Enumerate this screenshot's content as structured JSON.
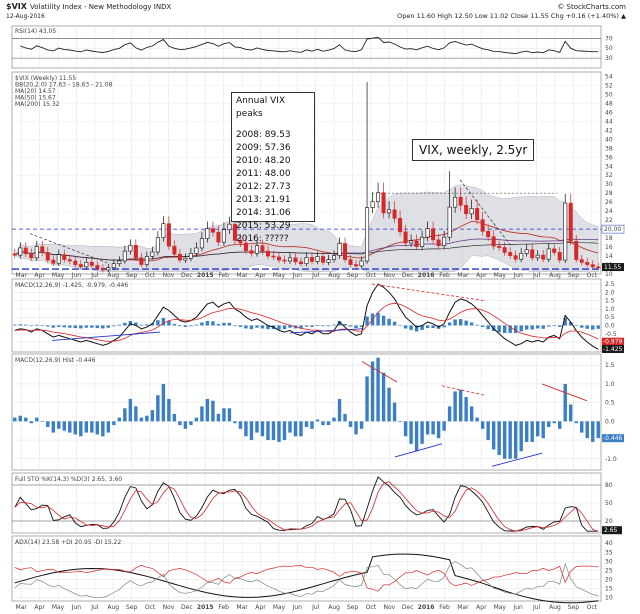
{
  "header": {
    "ticker": "$VIX",
    "name": "Volatility Index - New Methodology  INDX",
    "date": "12-Aug-2016",
    "quote": "Open 11.60  High 12.50  Low 11.02  Close 11.55  Chg +0.16 (+1.40%) ▲",
    "copyright": "© StockCharts.com"
  },
  "panels": {
    "rsi": {
      "label": "RSI(14) 43.05",
      "ticks": [
        "70",
        "50",
        "30"
      ]
    },
    "main": {
      "legend": [
        "$VIX (Weekly) 11.55",
        "BB(20,2.0) 17.63 - 18.63 - 21.08",
        "MA(20) 14.57",
        "MA(50) 15.67",
        "MA(200) 15.32"
      ],
      "ticks": [
        "54",
        "52",
        "50",
        "48",
        "46",
        "44",
        "42",
        "40",
        "38",
        "36",
        "34",
        "32",
        "30",
        "28",
        "26",
        "24",
        "22",
        "20",
        "18",
        "16",
        "14",
        "12",
        "10"
      ],
      "hline_upper": "20.00",
      "last_price": "11.55"
    },
    "macd1": {
      "label": "MACD(12,26,9) -1.425, -0.979, -0.446",
      "ticks": [
        "2.5",
        "2.0",
        "1.5",
        "1.0",
        "0.5",
        "0.0",
        "-0.5",
        "-1.0"
      ],
      "r1": "-0.979",
      "r2": "-1.425"
    },
    "macd2": {
      "label": "MACD(12,26,9) Hist -0.446",
      "ticks": [
        "1.5",
        "1.0",
        "0.5",
        "0.0",
        "-0.5",
        "-1.0"
      ],
      "r1": "-0.446"
    },
    "sto": {
      "label": "Full STO %K(14,3) %D(3) 2.65, 3.60",
      "ticks": [
        "80",
        "50",
        "20"
      ],
      "r1": "2.65"
    },
    "adx": {
      "label": "ADX(14) 23.58 +DI 20.95 -DI 15.22",
      "ticks": [
        "40",
        "35",
        "30",
        "25",
        "20",
        "15",
        "10"
      ]
    }
  },
  "annotations": {
    "peaks_title": "Annual VIX peaks",
    "peaks": [
      "2008: 89.53",
      "2009: 57.36",
      "2010: 48.20",
      "2011: 48.00",
      "2012: 27.73",
      "2013: 21.91",
      "2014: 31.06",
      "2015: 53.29",
      "2016: ?????"
    ],
    "caption": "VIX, weekly, 2.5yr"
  },
  "x_axis": {
    "labels": [
      "Mar",
      "Apr",
      "May",
      "Jun",
      "Jul",
      "Aug",
      "Sep",
      "Oct",
      "Nov",
      "Dec",
      "2015",
      "Feb",
      "Mar",
      "Apr",
      "May",
      "Jun",
      "Jul",
      "Aug",
      "Sep",
      "Oct",
      "Nov",
      "Dec",
      "2016",
      "Feb",
      "Mar",
      "Apr",
      "May",
      "Jun",
      "Jul",
      "Aug",
      "Sep",
      "Oct"
    ],
    "bold": [
      "2015",
      "2016"
    ]
  },
  "colors": {
    "down": "#d62828",
    "up": "#ffffff",
    "bb_fill": "#d6d9df",
    "hist": "#3a7fc4",
    "dash": "#2233cc",
    "ma_red": "#c0392b"
  },
  "chart_data": {
    "type": "candlestick",
    "title": "VIX, weekly, 2.5yr",
    "start": "2014-03",
    "interval": "weekly",
    "close": [
      14.2,
      15.8,
      14.5,
      13.6,
      16.1,
      14.8,
      13.1,
      12.4,
      14.3,
      13.2,
      12.9,
      12.1,
      11.6,
      12.6,
      11.9,
      11.3,
      10.9,
      11.4,
      12.3,
      12.9,
      15.1,
      16.4,
      13.6,
      12.1,
      13.9,
      14.9,
      18.1,
      21.2,
      16.2,
      14.4,
      13.1,
      13.5,
      14.6,
      15.8,
      17.9,
      20.1,
      19.3,
      17.1,
      19.9,
      21.1,
      17.5,
      16.9,
      15.2,
      14.6,
      16.3,
      15.1,
      14.0,
      13.8,
      13.1,
      12.9,
      13.6,
      12.7,
      12.3,
      13.7,
      12.8,
      13.9,
      12.6,
      13.2,
      14.1,
      16.8,
      13.2,
      12.1,
      11.8,
      12.9,
      24.8,
      26.1,
      28.1,
      23.6,
      24.3,
      22.4,
      19.4,
      16.9,
      17.4,
      16.1,
      18.2,
      20.1,
      17.6,
      16.3,
      18.2,
      24.9,
      27.1,
      25.3,
      23.4,
      24.6,
      22.1,
      19.5,
      18.3,
      16.2,
      15.9,
      14.8,
      14.1,
      13.3,
      14.6,
      15.4,
      13.6,
      14.2,
      13.3,
      15.6,
      14.8,
      13.1,
      25.8,
      17.3,
      13.2,
      12.6,
      12.1,
      11.6,
      11.5
    ],
    "series": [
      {
        "name": "MACD",
        "values": [
          -0.3,
          -0.2,
          -0.25,
          -0.4,
          -0.2,
          -0.3,
          -0.5,
          -0.7,
          -0.6,
          -0.7,
          -0.8,
          -0.9,
          -1.0,
          -0.9,
          -1.0,
          -1.1,
          -1.2,
          -1.1,
          -0.9,
          -0.7,
          -0.3,
          0.1,
          0.0,
          -0.2,
          -0.1,
          0.1,
          0.6,
          1.1,
          0.9,
          0.6,
          0.3,
          0.2,
          0.3,
          0.5,
          0.9,
          1.3,
          1.4,
          1.1,
          1.3,
          1.4,
          1.0,
          0.8,
          0.5,
          0.3,
          0.4,
          0.2,
          0.0,
          -0.1,
          -0.3,
          -0.4,
          -0.3,
          -0.5,
          -0.6,
          -0.4,
          -0.5,
          -0.3,
          -0.5,
          -0.5,
          -0.3,
          0.2,
          -0.1,
          -0.4,
          -0.6,
          -0.5,
          1.2,
          2.0,
          2.5,
          2.3,
          2.0,
          1.6,
          1.0,
          0.5,
          0.2,
          -0.1,
          0.0,
          0.2,
          0.1,
          -0.1,
          0.1,
          0.8,
          1.4,
          1.6,
          1.5,
          1.3,
          1.0,
          0.6,
          0.2,
          -0.2,
          -0.5,
          -0.8,
          -1.0,
          -1.2,
          -1.1,
          -0.9,
          -1.0,
          -0.9,
          -1.0,
          -0.7,
          -0.6,
          -0.8,
          0.6,
          0.2,
          -0.3,
          -0.7,
          -1.0,
          -1.25,
          -1.43
        ]
      },
      {
        "name": "Hist",
        "values": [
          0.1,
          0.15,
          0.1,
          -0.05,
          0.1,
          0.0,
          -0.15,
          -0.3,
          -0.2,
          -0.25,
          -0.3,
          -0.35,
          -0.4,
          -0.3,
          -0.3,
          -0.35,
          -0.4,
          -0.3,
          -0.1,
          0.1,
          0.35,
          0.6,
          0.4,
          0.1,
          0.15,
          0.3,
          0.7,
          1.0,
          0.6,
          0.2,
          -0.1,
          -0.2,
          -0.1,
          0.1,
          0.4,
          0.6,
          0.55,
          0.2,
          0.35,
          0.35,
          -0.05,
          -0.2,
          -0.4,
          -0.5,
          -0.3,
          -0.4,
          -0.5,
          -0.5,
          -0.55,
          -0.5,
          -0.3,
          -0.4,
          -0.4,
          -0.15,
          -0.2,
          0.05,
          -0.1,
          -0.1,
          0.1,
          0.6,
          0.2,
          -0.15,
          -0.35,
          -0.2,
          1.2,
          1.6,
          1.7,
          1.3,
          0.9,
          0.5,
          0.0,
          -0.4,
          -0.6,
          -0.8,
          -0.6,
          -0.35,
          -0.35,
          -0.45,
          -0.25,
          0.4,
          0.8,
          0.85,
          0.65,
          0.4,
          0.1,
          -0.2,
          -0.5,
          -0.75,
          -0.9,
          -1.0,
          -1.0,
          -1.0,
          -0.8,
          -0.55,
          -0.55,
          -0.4,
          -0.45,
          -0.15,
          -0.05,
          -0.2,
          1.0,
          0.45,
          -0.05,
          -0.3,
          -0.45,
          -0.55,
          -0.45
        ]
      }
    ],
    "ylim": [
      10,
      55
    ],
    "legend_position": "top-left",
    "grid": true
  }
}
